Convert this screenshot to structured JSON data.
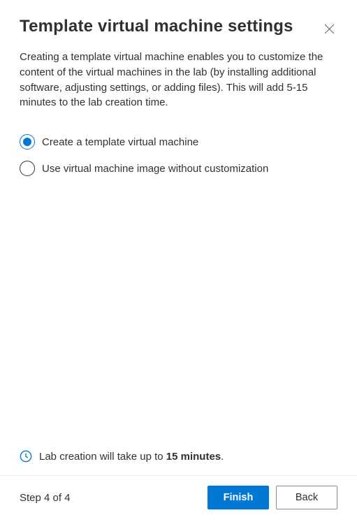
{
  "header": {
    "title": "Template virtual machine settings"
  },
  "description": "Creating a template virtual machine enables you to customize the content of the virtual machines in the lab (by installing additional software, adjusting settings, or adding files). This will add 5-15 minutes to the lab creation time.",
  "options": [
    {
      "label": "Create a template virtual machine",
      "selected": true
    },
    {
      "label": "Use virtual machine image without customization",
      "selected": false
    }
  ],
  "info": {
    "prefix": "Lab creation will take up to ",
    "bold": "15 minutes",
    "suffix": "."
  },
  "footer": {
    "step": "Step 4 of 4",
    "primary": "Finish",
    "secondary": "Back"
  }
}
